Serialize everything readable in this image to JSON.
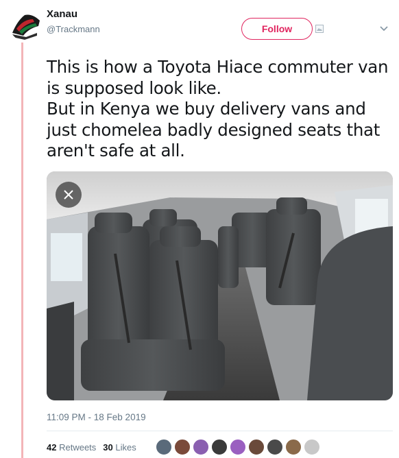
{
  "user": {
    "display_name": "Xanau",
    "handle": "@Trackmann"
  },
  "follow_label": "Follow",
  "tweet": {
    "lines": [
      "This is how a Toyota Hiace commuter van is supposed look like.",
      "But in Kenya we buy delivery vans and just chomelea badly designed seats that aren't safe at all."
    ]
  },
  "timestamp": "11:09 PM - 18 Feb 2019",
  "stats": {
    "retweets": "42",
    "retweets_label": "Retweets",
    "likes": "30",
    "likes_label": "Likes"
  },
  "colors": {
    "accent": "#e0245e",
    "thread": "#f3b5b8",
    "muted": "#657786"
  },
  "likers": [
    "#5a6a7a",
    "#7a4a3a",
    "#8a5fb0",
    "#3a3a3a",
    "#9a5fc0",
    "#6a4a3a",
    "#4a4a4a",
    "#8a6a4a",
    "#c8c8c8"
  ]
}
